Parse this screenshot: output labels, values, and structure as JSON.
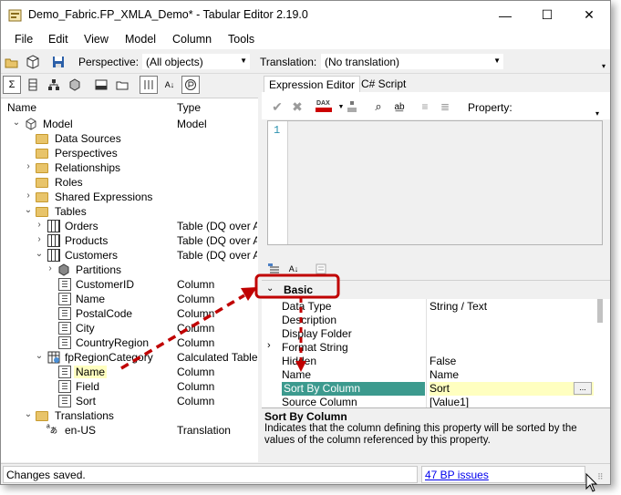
{
  "window": {
    "title": "Demo_Fabric.FP_XMLA_Demo* - Tabular Editor 2.19.0",
    "minimize": "—",
    "maximize": "☐",
    "close": "✕"
  },
  "menu": [
    "File",
    "Edit",
    "View",
    "Model",
    "Column",
    "Tools"
  ],
  "toolbar": {
    "perspective_label": "Perspective:",
    "perspective_value": "(All objects)",
    "translation_label": "Translation:",
    "translation_value": "(No translation)"
  },
  "tree": {
    "col_name": "Name",
    "col_type": "Type",
    "rows": [
      {
        "name": "Model",
        "type": "Model"
      },
      {
        "name": "Data Sources",
        "type": ""
      },
      {
        "name": "Perspectives",
        "type": ""
      },
      {
        "name": "Relationships",
        "type": ""
      },
      {
        "name": "Roles",
        "type": ""
      },
      {
        "name": "Shared Expressions",
        "type": ""
      },
      {
        "name": "Tables",
        "type": ""
      },
      {
        "name": "Orders",
        "type": "Table (DQ over AS)"
      },
      {
        "name": "Products",
        "type": "Table (DQ over AS)"
      },
      {
        "name": "Customers",
        "type": "Table (DQ over AS)"
      },
      {
        "name": "Partitions",
        "type": ""
      },
      {
        "name": "CustomerID",
        "type": "Column"
      },
      {
        "name": "Name",
        "type": "Column"
      },
      {
        "name": "PostalCode",
        "type": "Column"
      },
      {
        "name": "City",
        "type": "Column"
      },
      {
        "name": "CountryRegion",
        "type": "Column"
      },
      {
        "name": "fpRegionCategory",
        "type": "Calculated Table"
      },
      {
        "name": "Name",
        "type": "Column"
      },
      {
        "name": "Field",
        "type": "Column"
      },
      {
        "name": "Sort",
        "type": "Column"
      },
      {
        "name": "Translations",
        "type": ""
      },
      {
        "name": "en-US",
        "type": "Translation"
      }
    ]
  },
  "tabs": {
    "expression_editor": "Expression Editor",
    "csharp_script": "C# Script"
  },
  "editor": {
    "property_label": "Property:",
    "line_number": "1"
  },
  "properties": {
    "category": "Basic",
    "rows": [
      {
        "name": "Data Type",
        "value": "String / Text"
      },
      {
        "name": "Description",
        "value": ""
      },
      {
        "name": "Display Folder",
        "value": ""
      },
      {
        "name": "Format String",
        "value": ""
      },
      {
        "name": "Hidden",
        "value": "False"
      },
      {
        "name": "Name",
        "value": "Name"
      },
      {
        "name": "Sort By Column",
        "value": "Sort"
      },
      {
        "name": "Source Column",
        "value": "[Value1]"
      }
    ],
    "ellipsis": "..."
  },
  "description": {
    "title": "Sort By Column",
    "text": "Indicates that the column defining this property will be sorted by the values of the column referenced by this property."
  },
  "status": {
    "message": "Changes saved.",
    "bp_issues": "47 BP issues"
  }
}
